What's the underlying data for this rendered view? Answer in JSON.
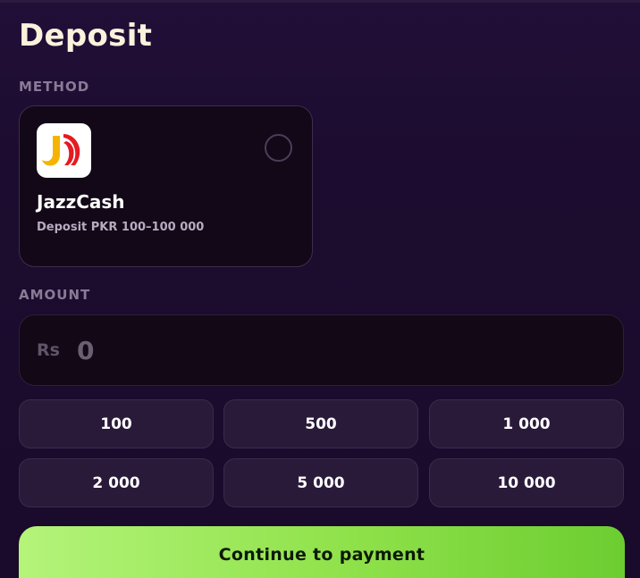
{
  "header": {
    "title": "Deposit"
  },
  "method_section": {
    "label": "METHOD",
    "selected": false,
    "method": {
      "name": "JazzCash",
      "limits": "Deposit PKR 100–100 000",
      "icon": "jazzcash-logo-icon",
      "brand_colors": [
        "#f5b400",
        "#e31b23"
      ]
    }
  },
  "amount_section": {
    "label": "AMOUNT",
    "currency_symbol": "Rs",
    "placeholder": "0",
    "value": ""
  },
  "presets": [
    "100",
    "500",
    "1 000",
    "2 000",
    "5 000",
    "10 000"
  ],
  "cta": {
    "label": "Continue to payment",
    "colors": [
      "#b4f47a",
      "#6ccd31"
    ]
  },
  "theme": {
    "background": "#1c0c2f",
    "card": "#120818",
    "preset_button": "#2a1a3a",
    "title_color": "#fbf2dc"
  }
}
